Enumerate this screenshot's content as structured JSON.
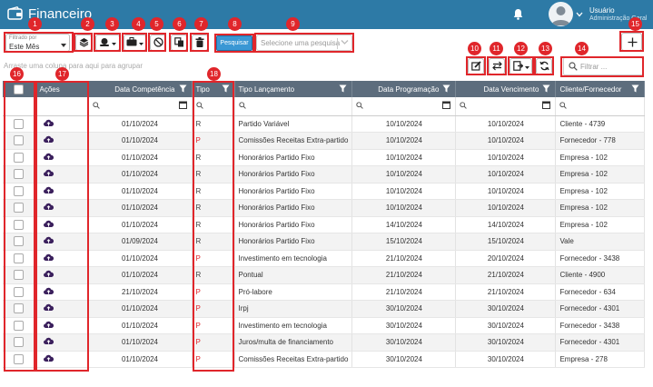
{
  "app": {
    "title": "Financeiro"
  },
  "user": {
    "name": "Usuário",
    "role": "Administração Geral"
  },
  "filter_select": {
    "label": "Filtrado por",
    "value": "Este Mês"
  },
  "search": {
    "button_label": "Pesquisar",
    "select_placeholder": "Selecione uma pesquisa"
  },
  "group_hint": "Arraste uma coluna para aqui para agrupar",
  "quick_filter": {
    "placeholder": "Filtrar ..."
  },
  "columns": {
    "acoes": "Ações",
    "data_competencia": "Data Competência",
    "tipo": "Tipo",
    "tipo_lancamento": "Tipo Lançamento",
    "data_programacao": "Data Programação",
    "data_vencimento": "Data Vencimento",
    "cliente_fornecedor": "Cliente/Fornecedor"
  },
  "rows": [
    {
      "competencia": "01/10/2024",
      "tipo": "R",
      "lancamento": "Partido Variável",
      "programacao": "10/10/2024",
      "vencimento": "10/10/2024",
      "cliente": "Cliente - 4739"
    },
    {
      "competencia": "01/10/2024",
      "tipo": "P",
      "lancamento": "Comissões Receitas Extra-partido",
      "programacao": "10/10/2024",
      "vencimento": "10/10/2024",
      "cliente": "Fornecedor - 778"
    },
    {
      "competencia": "01/10/2024",
      "tipo": "R",
      "lancamento": "Honorários Partido Fixo",
      "programacao": "10/10/2024",
      "vencimento": "10/10/2024",
      "cliente": "Empresa - 102"
    },
    {
      "competencia": "01/10/2024",
      "tipo": "R",
      "lancamento": "Honorários Partido Fixo",
      "programacao": "10/10/2024",
      "vencimento": "10/10/2024",
      "cliente": "Empresa - 102"
    },
    {
      "competencia": "01/10/2024",
      "tipo": "R",
      "lancamento": "Honorários Partido Fixo",
      "programacao": "10/10/2024",
      "vencimento": "10/10/2024",
      "cliente": "Empresa - 102"
    },
    {
      "competencia": "01/10/2024",
      "tipo": "R",
      "lancamento": "Honorários Partido Fixo",
      "programacao": "10/10/2024",
      "vencimento": "10/10/2024",
      "cliente": "Empresa - 102"
    },
    {
      "competencia": "01/10/2024",
      "tipo": "R",
      "lancamento": "Honorários Partido Fixo",
      "programacao": "14/10/2024",
      "vencimento": "14/10/2024",
      "cliente": "Empresa - 102"
    },
    {
      "competencia": "01/09/2024",
      "tipo": "R",
      "lancamento": "Honorários Partido Fixo",
      "programacao": "15/10/2024",
      "vencimento": "15/10/2024",
      "cliente": "Vale"
    },
    {
      "competencia": "01/10/2024",
      "tipo": "P",
      "lancamento": "Investimento em tecnologia",
      "programacao": "21/10/2024",
      "vencimento": "20/10/2024",
      "cliente": "Fornecedor - 3438"
    },
    {
      "competencia": "01/10/2024",
      "tipo": "R",
      "lancamento": "Pontual",
      "programacao": "21/10/2024",
      "vencimento": "21/10/2024",
      "cliente": "Cliente - 4900"
    },
    {
      "competencia": "21/10/2024",
      "tipo": "P",
      "lancamento": "Pró-labore",
      "programacao": "21/10/2024",
      "vencimento": "21/10/2024",
      "cliente": "Fornecedor - 634"
    },
    {
      "competencia": "01/10/2024",
      "tipo": "P",
      "lancamento": "Irpj",
      "programacao": "30/10/2024",
      "vencimento": "30/10/2024",
      "cliente": "Fornecedor - 4301"
    },
    {
      "competencia": "01/10/2024",
      "tipo": "P",
      "lancamento": "Investimento em tecnologia",
      "programacao": "30/10/2024",
      "vencimento": "30/10/2024",
      "cliente": "Fornecedor - 3438"
    },
    {
      "competencia": "01/10/2024",
      "tipo": "P",
      "lancamento": "Juros/multa de financiamento",
      "programacao": "30/10/2024",
      "vencimento": "30/10/2024",
      "cliente": "Fornecedor - 4301"
    },
    {
      "competencia": "01/10/2024",
      "tipo": "P",
      "lancamento": "Comissões Receitas Extra-partido",
      "programacao": "30/10/2024",
      "vencimento": "30/10/2024",
      "cliente": "Empresa - 278"
    }
  ],
  "annotations": [
    "1",
    "2",
    "3",
    "4",
    "5",
    "6",
    "7",
    "8",
    "9",
    "10",
    "11",
    "12",
    "13",
    "14",
    "15",
    "16",
    "17",
    "18"
  ],
  "colors": {
    "header": "#2d7aa6",
    "grid_header": "#5d6d7d",
    "marker": "#e0262b",
    "primary": "#3a97d4"
  },
  "icons": [
    "wallet-icon",
    "bell-icon",
    "user-avatar-icon",
    "layers-icon",
    "coins-icon",
    "briefcase-icon",
    "ban-icon",
    "copy-icon",
    "trash-icon",
    "edit-icon",
    "transfer-icon",
    "export-icon",
    "refresh-icon",
    "search-icon",
    "plus-icon",
    "filter-icon",
    "calendar-icon",
    "cloud-upload-icon"
  ]
}
